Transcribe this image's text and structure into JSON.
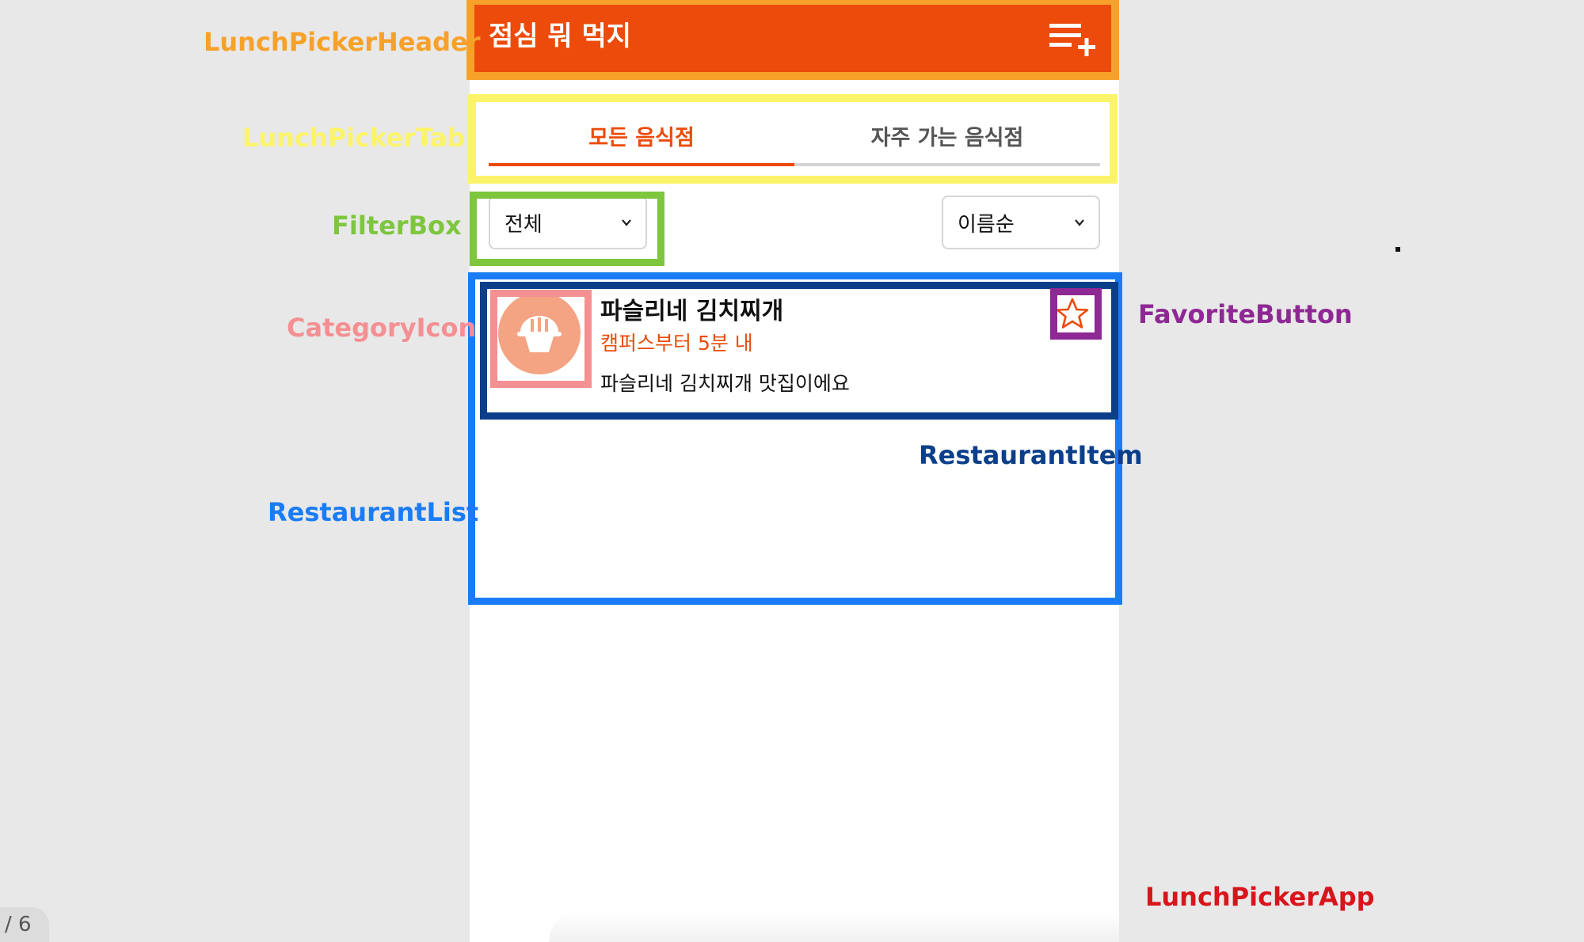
{
  "app": {
    "header_title": "점심 뭐 먹지",
    "tabs": [
      {
        "label": "모든 음식점",
        "active": true
      },
      {
        "label": "자주 가는 음식점",
        "active": false
      }
    ],
    "filters": {
      "category_selected": "전체",
      "sort_selected": "이름순"
    },
    "restaurants": [
      {
        "name": "파슬리네 김치찌개",
        "distance": "캠퍼스부터 5분 내",
        "description": "파슬리네 김치찌개 맛집이에요",
        "category_icon": "rice-bowl-icon",
        "favorite": false
      }
    ]
  },
  "annotations": {
    "header": "LunchPickerHeader",
    "tab": "LunchPickerTab",
    "filter_box": "FilterBox",
    "category_icon": "CategoryIcon",
    "favorite_button": "FavoriteButton",
    "restaurant_item": "RestaurantItem",
    "restaurant_list": "RestaurantList",
    "app": "LunchPickerApp"
  },
  "annotation_colors": {
    "header": "#f7a12a",
    "tab": "#fbf46a",
    "filter_box": "#7dc63e",
    "category_icon": "#f48f92",
    "favorite_button": "#8e2894",
    "restaurant_item": "#0b3f8a",
    "restaurant_list": "#1a7cf5",
    "app": "#d8151b"
  },
  "page_indicator": "/ 6",
  "colors": {
    "brand": "#ec4b0b",
    "icon_bg": "#f4a383"
  }
}
